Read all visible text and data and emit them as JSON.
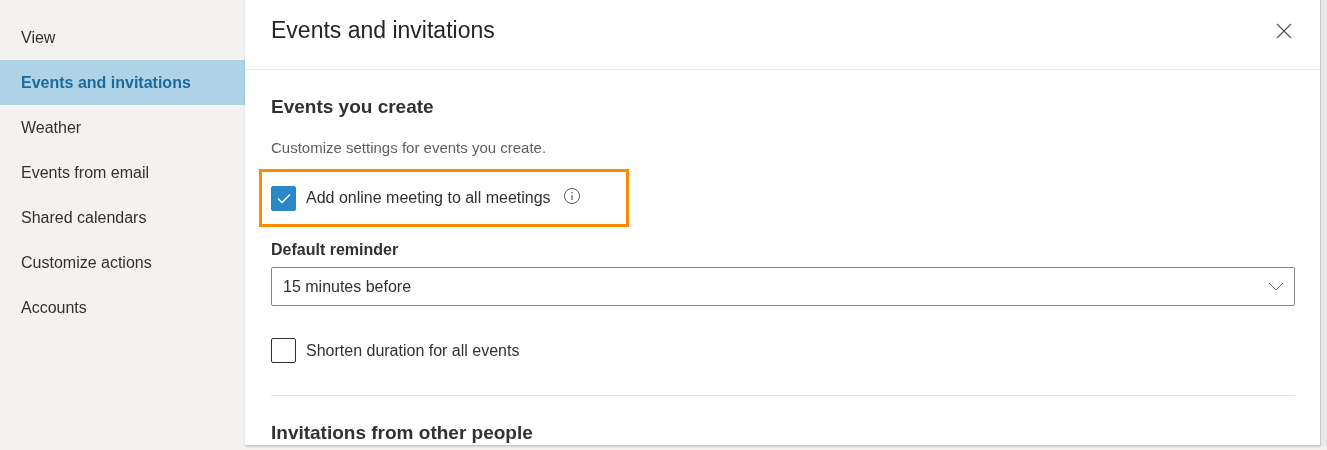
{
  "sidebar": {
    "items": [
      {
        "label": "View",
        "selected": false
      },
      {
        "label": "Events and invitations",
        "selected": true
      },
      {
        "label": "Weather",
        "selected": false
      },
      {
        "label": "Events from email",
        "selected": false
      },
      {
        "label": "Shared calendars",
        "selected": false
      },
      {
        "label": "Customize actions",
        "selected": false
      },
      {
        "label": "Accounts",
        "selected": false
      }
    ]
  },
  "panel": {
    "title": "Events and invitations",
    "section": {
      "heading": "Events you create",
      "description": "Customize settings for events you create.",
      "online_meeting": {
        "label": "Add online meeting to all meetings",
        "checked": true,
        "highlighted": true
      },
      "reminder": {
        "label": "Default reminder",
        "value": "15 minutes before"
      },
      "shorten": {
        "label": "Shorten duration for all events",
        "checked": false
      }
    },
    "next_section": {
      "heading": "Invitations from other people"
    }
  }
}
